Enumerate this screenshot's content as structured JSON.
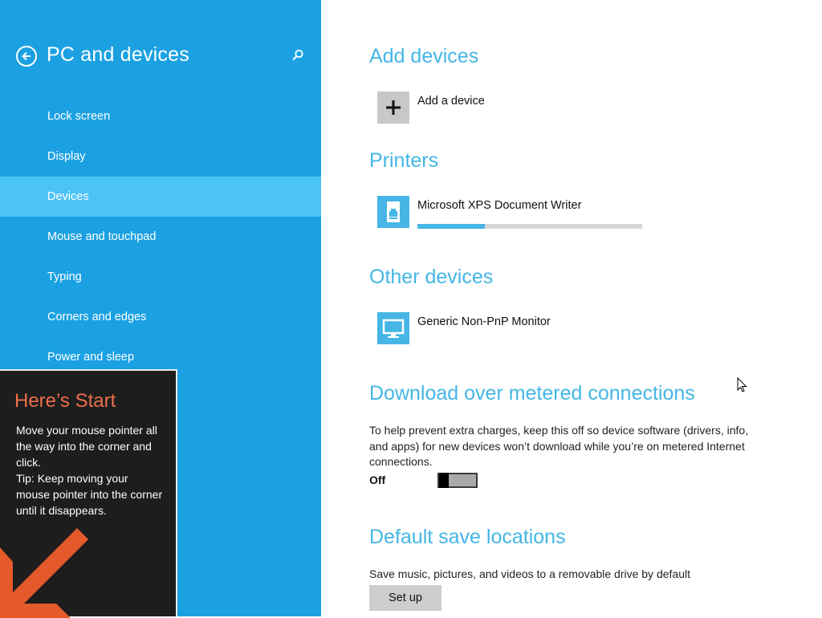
{
  "sidebar": {
    "title": "PC and devices",
    "items": [
      {
        "label": "Lock screen",
        "active": false
      },
      {
        "label": "Display",
        "active": false
      },
      {
        "label": "Devices",
        "active": true
      },
      {
        "label": "Mouse and touchpad",
        "active": false
      },
      {
        "label": "Typing",
        "active": false
      },
      {
        "label": "Corners and edges",
        "active": false
      },
      {
        "label": "Power and sleep",
        "active": false
      }
    ]
  },
  "start_tip": {
    "title": "Here’s Start",
    "body": "Move your mouse pointer all the way into the corner and click.\nTip: Keep moving your mouse pointer into the corner until it disappears."
  },
  "add_devices": {
    "heading": "Add devices",
    "add_label": "Add a device"
  },
  "printers": {
    "heading": "Printers",
    "items": [
      {
        "label": "Microsoft XPS Document Writer",
        "progress": 0.3,
        "icon": "printer-icon"
      }
    ]
  },
  "other_devices": {
    "heading": "Other devices",
    "items": [
      {
        "label": "Generic Non-PnP Monitor",
        "icon": "monitor-icon"
      }
    ]
  },
  "metered": {
    "heading": "Download over metered connections",
    "description": "To help prevent extra charges, keep this off so device software (drivers, info, and apps) for new devices won’t download while you’re on metered Internet connections.",
    "toggle_label": "Off",
    "toggle_on": false
  },
  "save_locations": {
    "heading": "Default save locations",
    "description": "Save music, pictures, and videos to a removable drive by default",
    "button_label": "Set up"
  },
  "colors": {
    "accent": "#1ba1e2",
    "active_item": "#4cc3f5",
    "heading": "#45b6e5",
    "tip_title": "#ec6f4a"
  }
}
